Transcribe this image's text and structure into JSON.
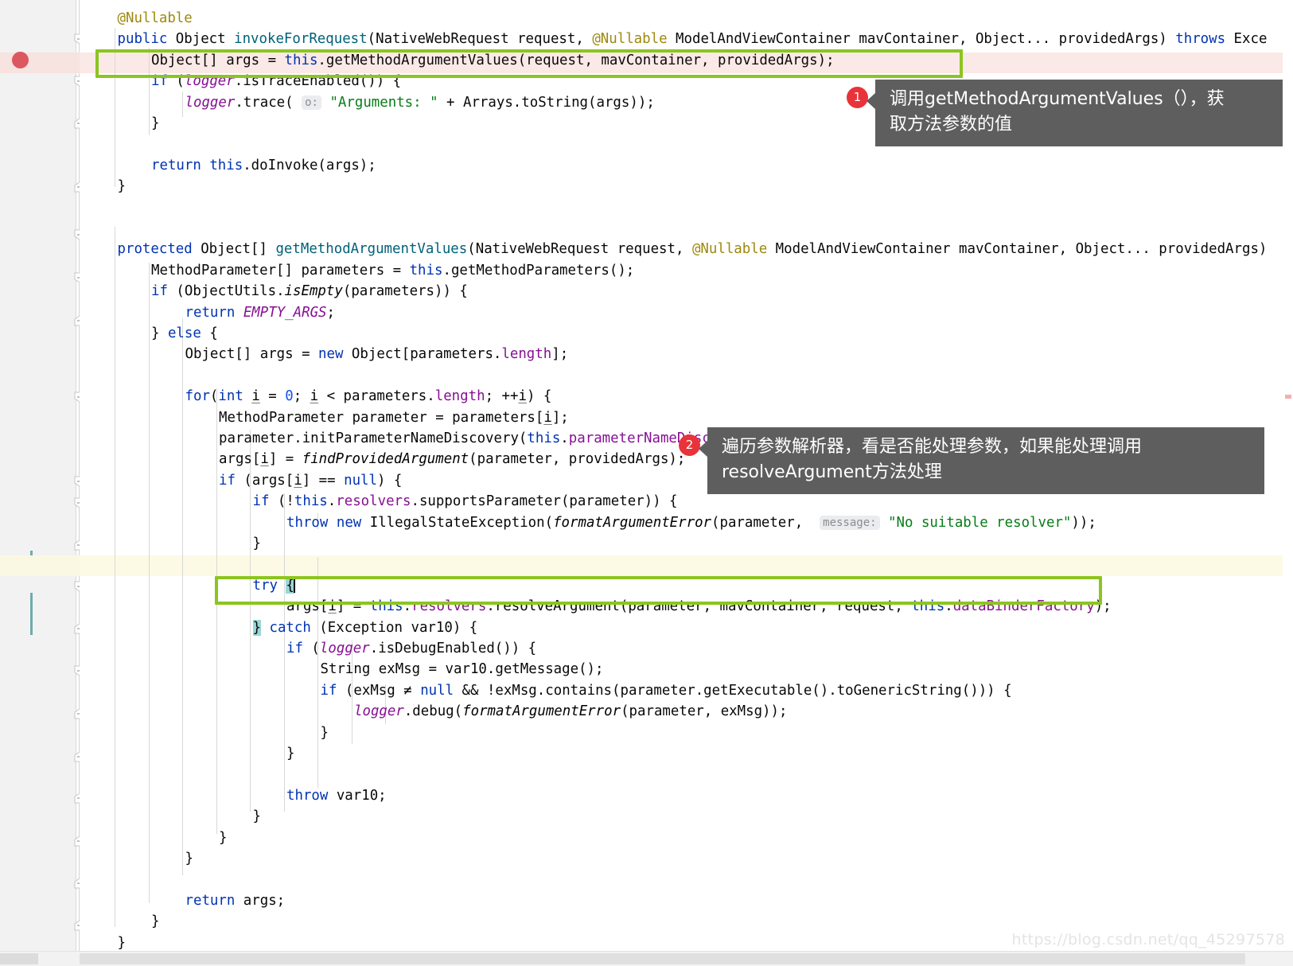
{
  "editor": {
    "language": "java",
    "font_size_px": 17.4,
    "line_height_px": 26.4,
    "colors": {
      "background": "#ffffff",
      "gutter": "#f2f2f2",
      "keyword": "#0033b3",
      "string": "#067d17",
      "number": "#1750eb",
      "annotation": "#9e880d",
      "field": "#871094",
      "method_declaration": "#00627a",
      "breakpoint": "#db5860",
      "highlight_box": "#8cc520",
      "callout_bg": "#5e5e5e",
      "badge_bg": "#e8333a",
      "modified_line_marker": "#6cacae",
      "caret_row": "#fcfae4",
      "breakpoint_row": "#fbe9e7",
      "brace_match": "#9ad6d6"
    }
  },
  "code_lines": [
    {
      "n": 0,
      "indent": 1,
      "text": "@Nullable"
    },
    {
      "n": 1,
      "indent": 1,
      "text": "public Object invokeForRequest(NativeWebRequest request, @Nullable ModelAndViewContainer mavContainer, Object... providedArgs) throws Exce"
    },
    {
      "n": 2,
      "indent": 2,
      "text": "Object[] args = this.getMethodArgumentValues(request, mavContainer, providedArgs);"
    },
    {
      "n": 3,
      "indent": 2,
      "text": "if (logger.isTraceEnabled()) {"
    },
    {
      "n": 4,
      "indent": 3,
      "text": "logger.trace( o: \"Arguments: \" + Arrays.toString(args));"
    },
    {
      "n": 5,
      "indent": 2,
      "text": "}"
    },
    {
      "n": 6,
      "indent": 0,
      "text": ""
    },
    {
      "n": 7,
      "indent": 2,
      "text": "return this.doInvoke(args);"
    },
    {
      "n": 8,
      "indent": 1,
      "text": "}"
    },
    {
      "n": 9,
      "indent": 0,
      "text": ""
    },
    {
      "n": 10,
      "indent": 0,
      "text": ""
    },
    {
      "n": 11,
      "indent": 1,
      "text": "protected Object[] getMethodArgumentValues(NativeWebRequest request, @Nullable ModelAndViewContainer mavContainer, Object... providedArgs)"
    },
    {
      "n": 12,
      "indent": 2,
      "text": "MethodParameter[] parameters = this.getMethodParameters();"
    },
    {
      "n": 13,
      "indent": 2,
      "text": "if (ObjectUtils.isEmpty(parameters)) {"
    },
    {
      "n": 14,
      "indent": 3,
      "text": "return EMPTY_ARGS;"
    },
    {
      "n": 15,
      "indent": 2,
      "text": "} else {"
    },
    {
      "n": 16,
      "indent": 3,
      "text": "Object[] args = new Object[parameters.length];"
    },
    {
      "n": 17,
      "indent": 0,
      "text": ""
    },
    {
      "n": 18,
      "indent": 3,
      "text": "for(int i = 0; i < parameters.length; ++i) {"
    },
    {
      "n": 19,
      "indent": 4,
      "text": "MethodParameter parameter = parameters[i];"
    },
    {
      "n": 20,
      "indent": 4,
      "text": "parameter.initParameterNameDiscovery(this.parameterNameDiscoverer);"
    },
    {
      "n": 21,
      "indent": 4,
      "text": "args[i] = findProvidedArgument(parameter, providedArgs);"
    },
    {
      "n": 22,
      "indent": 4,
      "text": "if (args[i] == null) {"
    },
    {
      "n": 23,
      "indent": 5,
      "text": "if (!this.resolvers.supportsParameter(parameter)) {"
    },
    {
      "n": 24,
      "indent": 6,
      "text": "throw new IllegalStateException(formatArgumentError(parameter,  message: \"No suitable resolver\"));"
    },
    {
      "n": 25,
      "indent": 5,
      "text": "}"
    },
    {
      "n": 26,
      "indent": 0,
      "text": ""
    },
    {
      "n": 27,
      "indent": 5,
      "text": "try {"
    },
    {
      "n": 28,
      "indent": 6,
      "text": "args[i] = this.resolvers.resolveArgument(parameter, mavContainer, request, this.dataBinderFactory);"
    },
    {
      "n": 29,
      "indent": 5,
      "text": "} catch (Exception var10) {"
    },
    {
      "n": 30,
      "indent": 6,
      "text": "if (logger.isDebugEnabled()) {"
    },
    {
      "n": 31,
      "indent": 7,
      "text": "String exMsg = var10.getMessage();"
    },
    {
      "n": 32,
      "indent": 7,
      "text": "if (exMsg != null && !exMsg.contains(parameter.getExecutable().toGenericString())) {"
    },
    {
      "n": 33,
      "indent": 8,
      "text": "logger.debug(formatArgumentError(parameter, exMsg));"
    },
    {
      "n": 34,
      "indent": 7,
      "text": "}"
    },
    {
      "n": 35,
      "indent": 6,
      "text": "}"
    },
    {
      "n": 36,
      "indent": 0,
      "text": ""
    },
    {
      "n": 37,
      "indent": 6,
      "text": "throw var10;"
    },
    {
      "n": 38,
      "indent": 5,
      "text": "}"
    },
    {
      "n": 39,
      "indent": 4,
      "text": "}"
    },
    {
      "n": 40,
      "indent": 3,
      "text": "}"
    },
    {
      "n": 41,
      "indent": 0,
      "text": ""
    },
    {
      "n": 42,
      "indent": 3,
      "text": "return args;"
    },
    {
      "n": 43,
      "indent": 2,
      "text": "}"
    },
    {
      "n": 44,
      "indent": 1,
      "text": "}"
    }
  ],
  "annotations": [
    {
      "number": "1",
      "text_line_1": "调用getMethodArgumentValues（），获",
      "text_line_2": "取方法参数的值",
      "targets_line": "Object[] args = this.getMethodArgumentValues(request, mavContainer, providedArgs);"
    },
    {
      "number": "2",
      "text_line_1": "遍历参数解析器，看是否能处理参数，如果能处理调用",
      "text_line_2": "resolveArgument方法处理",
      "targets_line": "args[i] = this.resolvers.resolveArgument(parameter, mavContainer, request, this.dataBinderFactory);"
    }
  ],
  "highlight_boxes": [
    {
      "label": "getMethodArgumentValues-call-box"
    },
    {
      "label": "resolveArgument-call-box"
    }
  ],
  "gutter": {
    "breakpoint_present": true,
    "breakpoint_line_text": "Object[] args = this.getMethodArgumentValues(request, mavContainer, providedArgs);"
  },
  "watermark": "https://blog.csdn.net/qq_45297578"
}
